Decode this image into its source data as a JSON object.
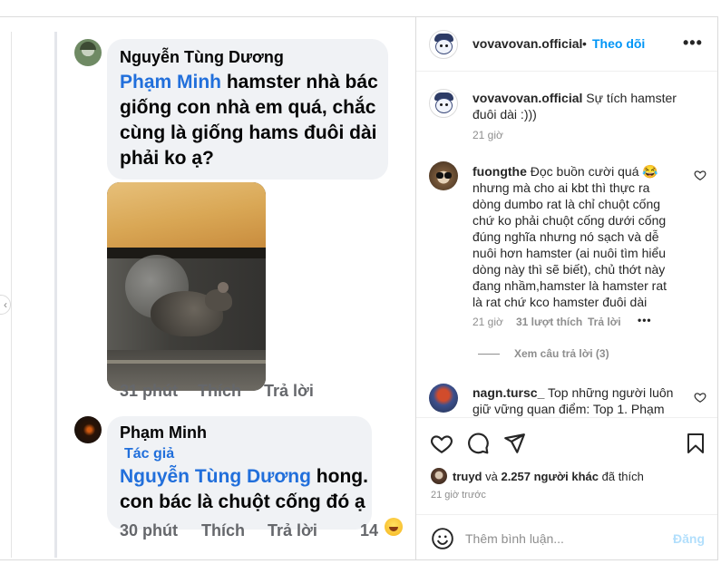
{
  "facebook": {
    "comment1": {
      "author": "Nguyễn Tùng Dương",
      "mention": "Phạm Minh",
      "text_line1_rest": " hamster nhà bác",
      "text_line2": "giống con nhà em quá, chắc",
      "text_line3": "cùng là giống hams đuôi dài",
      "text_line4": "phải ko ạ?",
      "time": "31 phút",
      "like": "Thích",
      "reply": "Trả lời"
    },
    "comment2": {
      "author": "Phạm Minh",
      "author_badge": "Tác giả",
      "mention": "Nguyễn Tùng Dương",
      "text_line1_rest": " hong.",
      "text_line2": "con bác là chuột cống đó ạ",
      "time": "30 phút",
      "like": "Thích",
      "reply": "Trả lời",
      "reaction_count": "14"
    }
  },
  "instagram": {
    "header": {
      "username": "vovavovan.official",
      "dot": "•",
      "follow": "Theo dõi",
      "more": "•••"
    },
    "caption": {
      "username": "vovavovan.official",
      "text": " Sự tích hamster đuôi dài :)))",
      "time": "21 giờ"
    },
    "comment1": {
      "username": "fuongthe",
      "text": " Đọc buồn cười quá 😂 nhưng mà cho ai kbt thì thực ra dòng dumbo rat là chỉ chuột cống chứ ko phải chuột cống dưới cống đúng nghĩa nhưng nó sạch và dễ nuôi hơn hamster (ai nuôi tìm hiểu dòng này thì sẽ biết), chủ thớt này đang nhầm,hamster là hamster rat là rat chứ kco hamster đuôi dài",
      "time": "21 giờ",
      "likes": "31 lượt thích",
      "reply": "Trả lời",
      "more": "•••",
      "view_replies": "Xem câu trả lời (3)"
    },
    "comment2": {
      "username": "nagn.tursc_",
      "text": " Top những người luôn giữ vững quan điểm: Top 1. Phạm"
    },
    "likes": {
      "first_user": "truyd",
      "and": " và ",
      "others": "2.257 người khác",
      "suffix": " đã thích",
      "time": "21 giờ trước"
    },
    "add_comment": {
      "placeholder": "Thêm bình luận...",
      "post": "Đăng"
    }
  }
}
